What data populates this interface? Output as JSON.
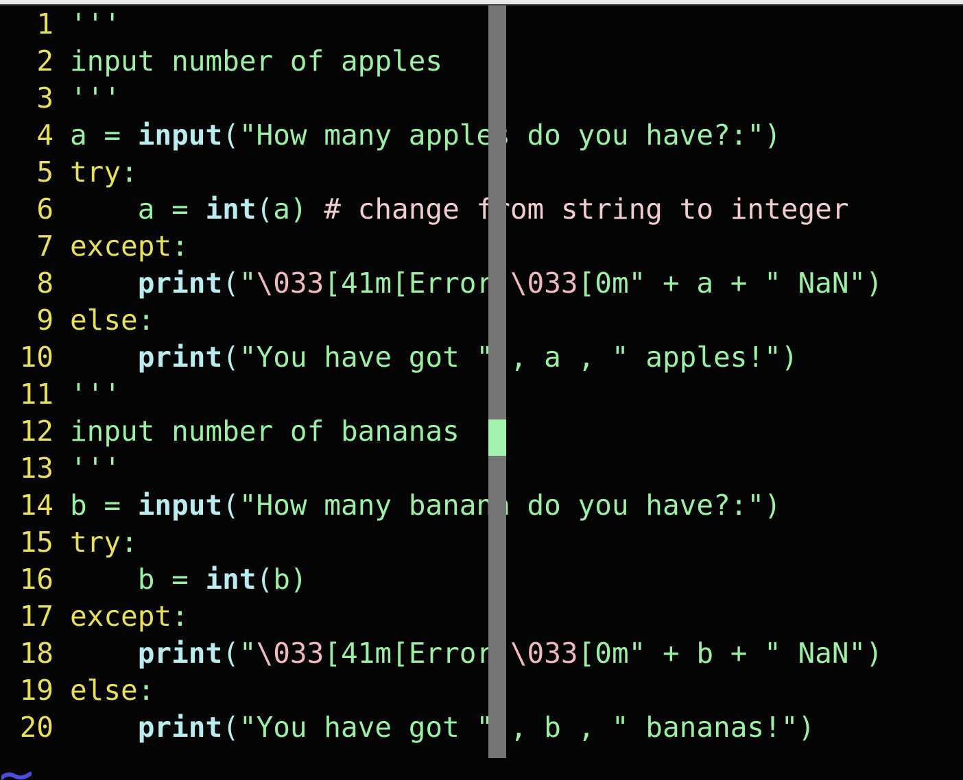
{
  "window": {
    "kind": "code-editor-viewport",
    "background_color": "#050505",
    "top_strip_color": "#e8e8e6"
  },
  "theme": {
    "line_number_color": "#e8e05a",
    "string_color": "#9bf0a5",
    "keyword_color": "#e8e05a",
    "builtin_color": "#b9ecef",
    "escape_color": "#f0b9bd",
    "comment_color": "#f2cdd0",
    "caret_color": "#a3f2b0",
    "overlay_bar_color": "#757575"
  },
  "overlay": {
    "vertical_bar_name": "vertical-scroll-overlay-bar",
    "caret_name": "text-caret",
    "caret_line": 12,
    "bottom_mark_name": "blue-glyph-fragment",
    "bottom_mark_color": "#4b4fd8"
  },
  "code": {
    "language": "python",
    "first_visible_line": 1,
    "last_visible_line": 20,
    "lines": [
      {
        "n": "1",
        "text": "'''"
      },
      {
        "n": "2",
        "text": "input number of apples"
      },
      {
        "n": "3",
        "text": "'''"
      },
      {
        "n": "4",
        "text": "a = input(\"How many apples do you have?:\")"
      },
      {
        "n": "5",
        "text": "try:"
      },
      {
        "n": "6",
        "text": "    a = int(a) # change from string to integer"
      },
      {
        "n": "7",
        "text": "except:"
      },
      {
        "n": "8",
        "text": "    print(\"\\033[41m[Error]\\033[0m\" + a + \" NaN\")"
      },
      {
        "n": "9",
        "text": "else:"
      },
      {
        "n": "10",
        "text": "    print(\"You have got \" , a , \" apples!\")"
      },
      {
        "n": "11",
        "text": "'''"
      },
      {
        "n": "12",
        "text": "input number of bananas"
      },
      {
        "n": "13",
        "text": "'''"
      },
      {
        "n": "14",
        "text": "b = input(\"How many banana do you have?:\")"
      },
      {
        "n": "15",
        "text": "try:"
      },
      {
        "n": "16",
        "text": "    b = int(b)"
      },
      {
        "n": "17",
        "text": "except:"
      },
      {
        "n": "18",
        "text": "    print(\"\\033[41m[Error]\\033[0m\" + b + \" NaN\")"
      },
      {
        "n": "19",
        "text": "else:"
      },
      {
        "n": "20",
        "text": "    print(\"You have got \" , b , \" bananas!\")"
      }
    ],
    "tokens": {
      "l1": [
        [
          "'''",
          "s-str"
        ]
      ],
      "l2": [
        [
          "input number of apples",
          "s-str"
        ]
      ],
      "l3": [
        [
          "'''",
          "s-str"
        ]
      ],
      "l4": [
        [
          "a = ",
          "s-plain"
        ],
        [
          "input",
          "s-fn"
        ],
        [
          "(",
          "s-paren"
        ],
        [
          "\"How many apples do you have?:\"",
          "s-str"
        ],
        [
          ")",
          "s-str"
        ]
      ],
      "l5": [
        [
          "try",
          "s-kw"
        ],
        [
          ":",
          "s-plain"
        ]
      ],
      "l6": [
        [
          "    a = ",
          "s-plain"
        ],
        [
          "int",
          "s-fn"
        ],
        [
          "(",
          "s-paren"
        ],
        [
          "a",
          "s-plain"
        ],
        [
          ") ",
          "s-plain"
        ],
        [
          "# change from string to integer",
          "s-cmt"
        ]
      ],
      "l7": [
        [
          "except",
          "s-kw"
        ],
        [
          ":",
          "s-plain"
        ]
      ],
      "l8": [
        [
          "    ",
          "s-plain"
        ],
        [
          "print",
          "s-fn"
        ],
        [
          "(",
          "s-paren"
        ],
        [
          "\"",
          "s-str"
        ],
        [
          "\\033",
          "s-esc"
        ],
        [
          "[41m[Error]",
          "s-str"
        ],
        [
          "\\033",
          "s-esc"
        ],
        [
          "[0m\"",
          "s-str"
        ],
        [
          " + a + ",
          "s-plain"
        ],
        [
          "\" NaN\"",
          "s-str"
        ],
        [
          ")",
          "s-str"
        ]
      ],
      "l9": [
        [
          "else",
          "s-kw"
        ],
        [
          ":",
          "s-plain"
        ]
      ],
      "l10": [
        [
          "    ",
          "s-plain"
        ],
        [
          "print",
          "s-fn"
        ],
        [
          "(",
          "s-paren"
        ],
        [
          "\"You have got \"",
          "s-str"
        ],
        [
          " , a , ",
          "s-plain"
        ],
        [
          "\" apples!\"",
          "s-str"
        ],
        [
          ")",
          "s-str"
        ]
      ],
      "l11": [
        [
          "'''",
          "s-str"
        ]
      ],
      "l12": [
        [
          "input number of bananas",
          "s-str"
        ]
      ],
      "l13": [
        [
          "'''",
          "s-str"
        ]
      ],
      "l14": [
        [
          "b = ",
          "s-plain"
        ],
        [
          "input",
          "s-fn"
        ],
        [
          "(",
          "s-paren"
        ],
        [
          "\"How many banana do you have?:\"",
          "s-str"
        ],
        [
          ")",
          "s-str"
        ]
      ],
      "l15": [
        [
          "try",
          "s-kw"
        ],
        [
          ":",
          "s-plain"
        ]
      ],
      "l16": [
        [
          "    b = ",
          "s-plain"
        ],
        [
          "int",
          "s-fn"
        ],
        [
          "(",
          "s-paren"
        ],
        [
          "b",
          "s-plain"
        ],
        [
          ")",
          "s-plain"
        ]
      ],
      "l17": [
        [
          "except",
          "s-kw"
        ],
        [
          ":",
          "s-plain"
        ]
      ],
      "l18": [
        [
          "    ",
          "s-plain"
        ],
        [
          "print",
          "s-fn"
        ],
        [
          "(",
          "s-paren"
        ],
        [
          "\"",
          "s-str"
        ],
        [
          "\\033",
          "s-esc"
        ],
        [
          "[41m[Error]",
          "s-str"
        ],
        [
          "\\033",
          "s-esc"
        ],
        [
          "[0m\"",
          "s-str"
        ],
        [
          " + b + ",
          "s-plain"
        ],
        [
          "\" NaN\"",
          "s-str"
        ],
        [
          ")",
          "s-str"
        ]
      ],
      "l19": [
        [
          "else",
          "s-kw"
        ],
        [
          ":",
          "s-plain"
        ]
      ],
      "l20": [
        [
          "    ",
          "s-plain"
        ],
        [
          "print",
          "s-fn"
        ],
        [
          "(",
          "s-paren"
        ],
        [
          "\"You have got \"",
          "s-str"
        ],
        [
          " , b , ",
          "s-plain"
        ],
        [
          "\" bananas!\"",
          "s-str"
        ],
        [
          ")",
          "s-str"
        ]
      ]
    }
  }
}
